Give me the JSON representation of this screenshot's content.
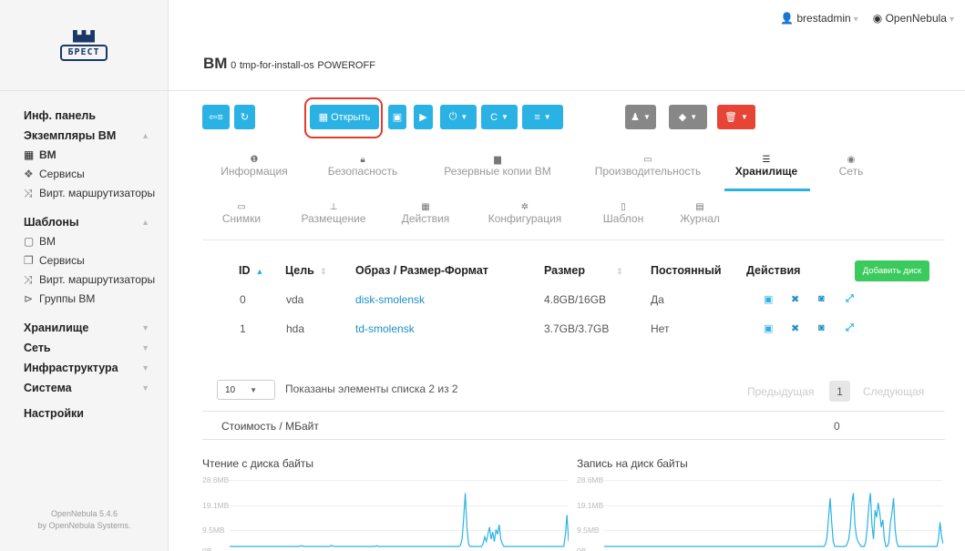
{
  "logo": {
    "text": "БРЕСТ"
  },
  "header": {
    "user": "brestadmin",
    "zone": "OpenNebula",
    "title": "ВМ",
    "vm_id": "0",
    "vm_name": "tmp-for-install-os",
    "vm_state": "POWEROFF"
  },
  "sidebar": {
    "dashboard": "Инф. панель",
    "instances": "Экземпляры ВМ",
    "inst_vm": "ВМ",
    "inst_services": "Сервисы",
    "inst_vrouters": "Вирт. маршрутизаторы",
    "templates": "Шаблоны",
    "tpl_vm": "ВМ",
    "tpl_services": "Сервисы",
    "tpl_vrouters": "Вирт. маршрутизаторы",
    "tpl_groups": "Группы ВМ",
    "storage": "Хранилище",
    "network": "Сеть",
    "infrastructure": "Инфраструктура",
    "system": "Система",
    "settings": "Настройки",
    "version": "OpenNebula 5.4.6",
    "by": "by OpenNebula Systems."
  },
  "toolbar": {
    "open_label": "Открыть",
    "accent_blue": "#2ab2e4",
    "accent_gray": "#878787",
    "accent_red": "#e64536",
    "highlight": "#e53a2c"
  },
  "tabs_row1": [
    {
      "label": "Информация",
      "icon": "info-icon"
    },
    {
      "label": "Безопасность",
      "icon": "lock-icon"
    },
    {
      "label": "Резервные копии ВМ",
      "icon": "archive-icon"
    },
    {
      "label": "Производительность",
      "icon": "laptop-icon"
    },
    {
      "label": "Хранилище",
      "icon": "tasks-icon"
    },
    {
      "label": "Сеть",
      "icon": "globe-icon"
    }
  ],
  "tabs_row2": [
    {
      "label": "Снимки",
      "icon": "laptop-icon"
    },
    {
      "label": "Размещение",
      "icon": "sitemap-icon"
    },
    {
      "label": "Действия",
      "icon": "calendar-icon"
    },
    {
      "label": "Конфигурация",
      "icon": "cog-icon"
    },
    {
      "label": "Шаблон",
      "icon": "file-icon"
    },
    {
      "label": "Журнал",
      "icon": "file-text-icon"
    }
  ],
  "disks": {
    "columns": [
      "ID",
      "Цель",
      "Образ / Размер-Формат",
      "Размер",
      "Постоянный",
      "Действия"
    ],
    "add_button": "Добавить диск",
    "rows": [
      {
        "id": "0",
        "target": "vda",
        "image": "disk-smolensk",
        "size": "4.8GB/16GB",
        "persistent": "Да"
      },
      {
        "id": "1",
        "target": "hda",
        "image": "td-smolensk",
        "size": "3.7GB/3.7GB",
        "persistent": "Нет"
      }
    ]
  },
  "pagination": {
    "page_size": "10",
    "info": "Показаны элементы списка 2 из 2",
    "prev": "Предыдущая",
    "page": "1",
    "next": "Следующая"
  },
  "cost": {
    "label": "Стоимость / МБайт",
    "value": "0"
  },
  "charts": {
    "read_title": "Чтение с диска байты",
    "write_title": "Запись на диск байты",
    "y_ticks": [
      "28.6MB",
      "19.1MB",
      "9.5MB",
      "0B"
    ]
  },
  "chart_data": [
    {
      "type": "line",
      "title": "Чтение с диска байты",
      "y_ticks": [
        "28.6MB",
        "19.1MB",
        "9.5MB",
        "0B"
      ],
      "ylim": [
        0,
        28.6
      ],
      "series": [
        {
          "values": [
            0,
            0,
            0,
            0,
            0,
            0,
            0,
            0,
            0,
            0,
            0,
            0,
            0,
            0,
            0,
            0,
            0,
            0,
            0,
            0,
            0,
            0,
            0,
            0,
            0,
            0,
            0,
            0,
            0,
            0,
            0,
            0,
            0,
            0,
            0,
            0,
            0,
            0,
            0,
            0,
            0,
            0,
            0,
            0,
            0.3,
            0.2,
            0,
            0,
            0,
            0,
            0,
            0,
            0,
            0,
            0,
            0,
            0,
            0,
            0,
            0,
            0,
            0,
            0,
            0.5,
            0.1,
            0,
            0,
            0,
            0,
            0,
            0,
            0,
            0,
            0,
            0,
            0,
            0,
            0,
            0,
            0,
            0,
            0,
            0,
            0,
            0,
            0,
            0,
            0,
            0,
            0,
            0,
            0.3,
            0,
            0,
            0,
            0,
            0,
            0,
            0,
            0,
            0,
            0,
            0,
            0,
            0,
            0,
            0,
            0,
            0,
            0,
            0,
            0,
            0,
            0,
            0,
            0,
            0,
            0,
            0,
            0,
            0,
            0,
            0,
            0,
            0,
            0,
            0,
            0,
            0,
            0,
            0,
            0,
            0,
            0,
            0,
            0,
            0,
            0,
            0,
            0,
            0,
            0,
            0,
            0.5,
            3,
            12,
            22,
            8,
            1,
            0,
            0,
            0,
            0,
            0,
            0,
            0,
            0,
            1,
            4,
            2,
            5,
            8,
            3,
            6,
            2,
            7,
            5,
            9,
            3,
            1,
            0,
            0,
            0,
            0,
            0,
            0,
            0,
            0,
            0,
            0,
            0,
            0,
            0,
            0,
            0,
            0,
            0,
            0,
            0,
            0,
            0,
            0,
            0,
            0,
            0,
            0,
            0,
            0,
            0,
            0,
            0,
            0,
            0,
            0,
            0,
            0,
            0,
            0,
            5,
            13,
            2
          ]
        }
      ]
    },
    {
      "type": "line",
      "title": "Запись на диск байты",
      "y_ticks": [
        "28.6MB",
        "19.1MB",
        "9.5MB",
        "0B"
      ],
      "ylim": [
        0,
        28.6
      ],
      "series": [
        {
          "values": [
            0,
            0,
            0,
            0,
            0,
            0,
            0,
            0,
            0,
            0,
            0,
            0,
            0,
            0,
            0,
            0,
            0,
            0,
            0,
            0,
            0,
            0,
            0,
            0,
            0,
            0,
            0,
            0,
            0,
            0,
            0,
            0,
            0,
            0,
            0,
            0,
            0,
            0,
            0,
            0,
            0,
            0,
            0,
            0,
            0,
            0,
            0,
            0,
            0,
            0,
            0,
            0,
            0,
            0,
            0,
            0,
            0,
            0,
            0,
            0,
            0,
            0,
            0,
            0,
            0,
            0,
            0,
            0,
            0,
            0,
            0,
            0,
            0,
            0,
            0,
            0,
            0,
            0,
            0,
            0,
            0,
            0,
            0,
            0,
            0,
            0,
            0,
            0,
            0,
            0,
            0,
            0,
            0,
            0,
            0,
            0,
            0,
            0,
            0,
            0,
            0,
            0,
            0,
            0,
            0,
            0,
            0,
            0,
            0,
            0,
            0,
            0,
            0,
            0,
            0,
            0,
            0,
            0,
            0,
            0,
            0,
            0,
            0,
            0,
            0,
            0,
            0,
            0,
            0,
            0,
            0,
            0,
            0,
            0,
            0,
            0,
            0,
            0,
            0,
            0,
            0,
            0,
            0,
            1,
            4,
            12,
            20,
            10,
            2,
            0,
            0,
            0,
            0,
            0,
            0,
            0,
            0,
            1,
            3,
            8,
            18,
            22,
            9,
            4,
            2,
            1,
            0,
            0,
            0,
            2,
            8,
            17,
            22,
            9,
            3,
            15,
            12,
            18,
            14,
            8,
            11,
            3,
            0,
            0,
            2,
            10,
            14,
            20,
            7,
            2,
            0,
            0,
            0,
            0,
            0,
            0,
            0,
            0,
            0,
            0,
            0,
            0,
            0,
            0,
            0,
            0,
            0,
            0,
            0,
            0,
            0,
            0,
            0,
            0,
            0,
            0,
            3,
            10,
            4,
            1
          ]
        }
      ]
    }
  ]
}
